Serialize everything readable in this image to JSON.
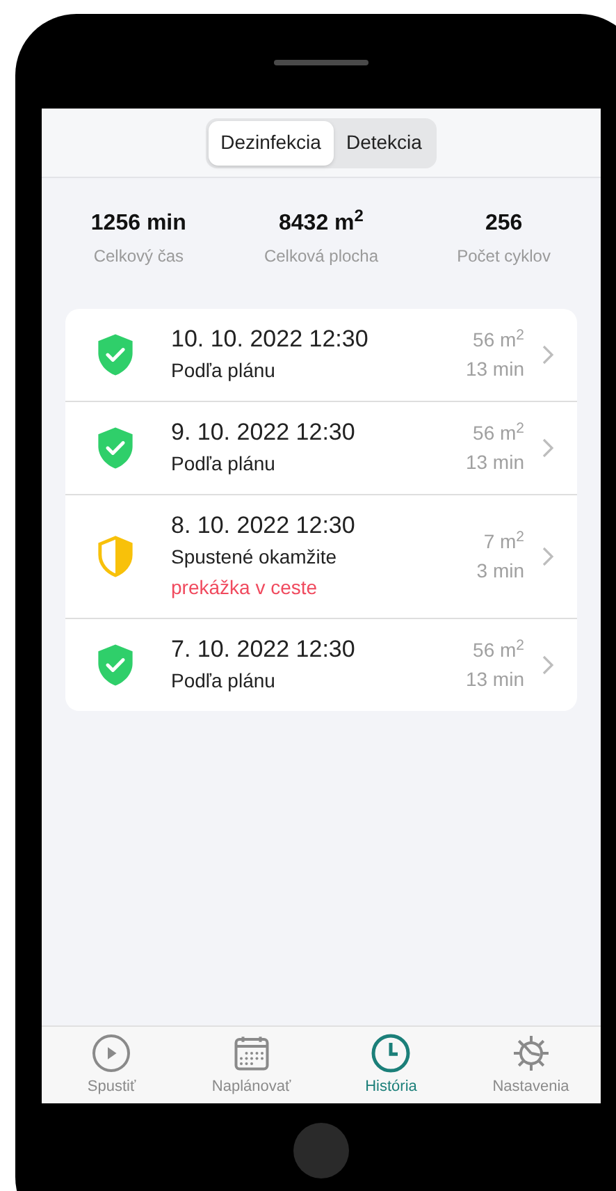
{
  "tabs": [
    {
      "label": "Dezinfekcia",
      "selected": true
    },
    {
      "label": "Detekcia",
      "selected": false
    }
  ],
  "stats": [
    {
      "value": "1256 min",
      "label": "Celkový čas"
    },
    {
      "value": "8432 m$^{2}$",
      "label": "Celková plocha"
    },
    {
      "value": "256",
      "label": "Počet cyklov"
    }
  ],
  "history": [
    {
      "kind": "ok",
      "date": "10. 10. 2022 12:30",
      "mode": "Podľa plánu",
      "area": "56 m$^{2}$",
      "duration": "13 min"
    },
    {
      "kind": "ok",
      "date": "9. 10. 2022 12:30",
      "mode": "Podľa plánu",
      "area": "56 m$^{2}$",
      "duration": "13 min"
    },
    {
      "kind": "partial",
      "date": "8. 10. 2022 12:30",
      "mode": "Spustené okamžite",
      "error": "prekážka v ceste",
      "area": "7 m$^{2}$",
      "duration": "3 min"
    },
    {
      "kind": "ok",
      "date": "7. 10. 2022 12:30",
      "mode": "Podľa plánu",
      "area": "56 m$^{2}$",
      "duration": "13 min"
    }
  ],
  "nav": [
    {
      "kind": "play",
      "label": "Spustiť",
      "selected": false
    },
    {
      "kind": "calendar",
      "label": "Naplánovať",
      "selected": false
    },
    {
      "kind": "clock",
      "label": "História",
      "selected": true
    },
    {
      "kind": "gear",
      "label": "Nastavenia",
      "selected": false
    }
  ]
}
